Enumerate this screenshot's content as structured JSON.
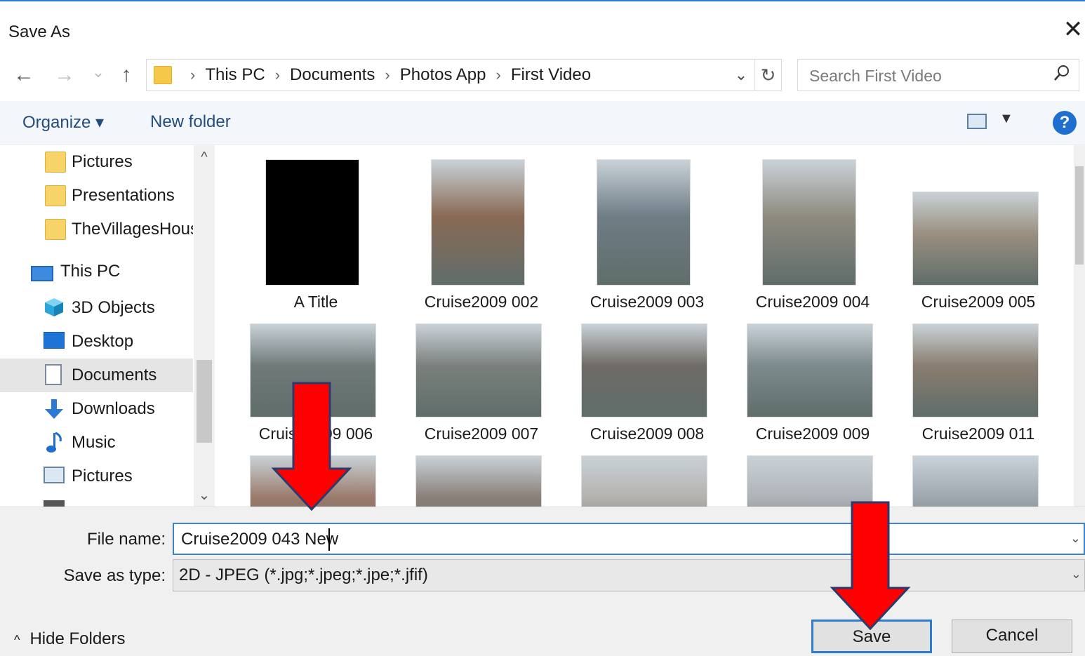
{
  "window": {
    "title": "Save As",
    "close_symbol": "✕"
  },
  "nav": {
    "back_symbol": "←",
    "forward_symbol": "→",
    "recent_symbol": "⌄",
    "up_symbol": "↑",
    "breadcrumbs": [
      "This PC",
      "Documents",
      "Photos App",
      "First Video"
    ],
    "separator": "›",
    "refresh_symbol": "↻",
    "search_placeholder": "Search First Video",
    "search_symbol": "⚲"
  },
  "toolbar": {
    "organize_label": "Organize ▾",
    "new_folder_label": "New folder",
    "help_symbol": "?"
  },
  "sidebar": {
    "items": [
      {
        "label": "Pictures",
        "icon": "folder-icon"
      },
      {
        "label": "Presentations",
        "icon": "folder-icon"
      },
      {
        "label": "TheVillagesHous",
        "icon": "folder-icon"
      },
      {
        "label": "This PC",
        "icon": "computer-icon"
      },
      {
        "label": "3D Objects",
        "icon": "cube-icon"
      },
      {
        "label": "Desktop",
        "icon": "desktop-icon"
      },
      {
        "label": "Documents",
        "icon": "documents-icon",
        "selected": true
      },
      {
        "label": "Downloads",
        "icon": "download-icon"
      },
      {
        "label": "Music",
        "icon": "music-icon"
      },
      {
        "label": "Pictures",
        "icon": "pictures-icon"
      }
    ]
  },
  "files": [
    {
      "label": "A Title",
      "color": "#000000"
    },
    {
      "label": "Cruise2009 002",
      "color": "#8a6a55"
    },
    {
      "label": "Cruise2009 003",
      "color": "#6f7d86"
    },
    {
      "label": "Cruise2009 004",
      "color": "#8f8b80"
    },
    {
      "label": "Cruise2009 005",
      "color": "#9a8f80"
    },
    {
      "label": "Cruise2009 006",
      "color": "#6f7a78"
    },
    {
      "label": "Cruise2009 007",
      "color": "#7a807c"
    },
    {
      "label": "Cruise2009 008",
      "color": "#6f6b66"
    },
    {
      "label": "Cruise2009 009",
      "color": "#7d8a8d"
    },
    {
      "label": "Cruise2009 011",
      "color": "#8a7d70"
    },
    {
      "label": "",
      "color": "#9a7a6a"
    },
    {
      "label": "",
      "color": "#8a7f78"
    },
    {
      "label": "",
      "color": "#b5b2ae"
    },
    {
      "label": "",
      "color": "#aeb3b8"
    },
    {
      "label": "",
      "color": "#9fa7ae"
    }
  ],
  "form": {
    "file_name_label": "File name:",
    "file_name_value": "Cruise2009 043 New",
    "save_as_type_label": "Save as type:",
    "save_as_type_value": "2D - JPEG (*.jpg;*.jpeg;*.jpe;*.jfif)",
    "dropdown_symbol": "⌄"
  },
  "footer": {
    "hide_folders_label": "Hide Folders",
    "save_label": "Save",
    "cancel_label": "Cancel"
  },
  "colors": {
    "accent": "#2f7bd0",
    "annotation_arrow": "#ff0000"
  }
}
